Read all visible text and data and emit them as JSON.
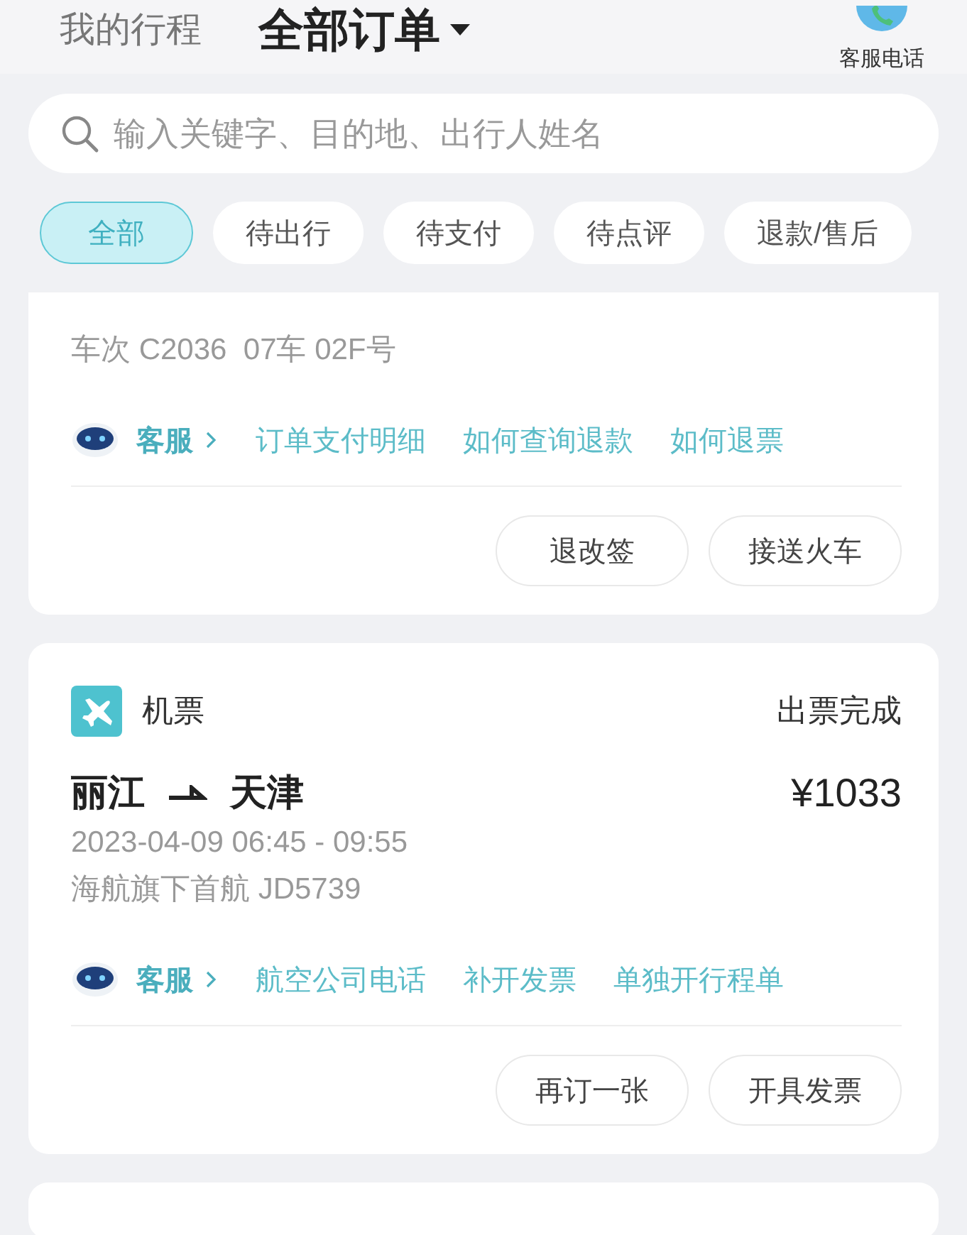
{
  "header": {
    "tabs": [
      {
        "label": "我的行程",
        "selected": false
      },
      {
        "label": "全部订单",
        "selected": true
      }
    ],
    "service": {
      "label": "客服电话"
    }
  },
  "search": {
    "placeholder": "输入关键字、目的地、出行人姓名"
  },
  "filters": [
    {
      "label": "全部",
      "selected": true
    },
    {
      "label": "待出行",
      "selected": false
    },
    {
      "label": "待支付",
      "selected": false
    },
    {
      "label": "待点评",
      "selected": false
    },
    {
      "label": "退款/售后",
      "selected": false
    }
  ],
  "orders": [
    {
      "kind": "train",
      "details": [
        "车次 C2036  07车 02F号"
      ],
      "service_label": "客服",
      "links": [
        "订单支付明细",
        "如何查询退款",
        "如何退票"
      ],
      "actions": [
        "退改签",
        "接送火车"
      ]
    },
    {
      "kind": "flight",
      "category": "机票",
      "status": "出票完成",
      "from": "丽江",
      "to": "天津",
      "price": "¥1033",
      "details": [
        "2023-04-09 06:45 - 09:55",
        "海航旗下首航 JD5739"
      ],
      "service_label": "客服",
      "links": [
        "航空公司电话",
        "补开发票",
        "单独开行程单"
      ],
      "actions": [
        "再订一张",
        "开具发票"
      ]
    }
  ]
}
